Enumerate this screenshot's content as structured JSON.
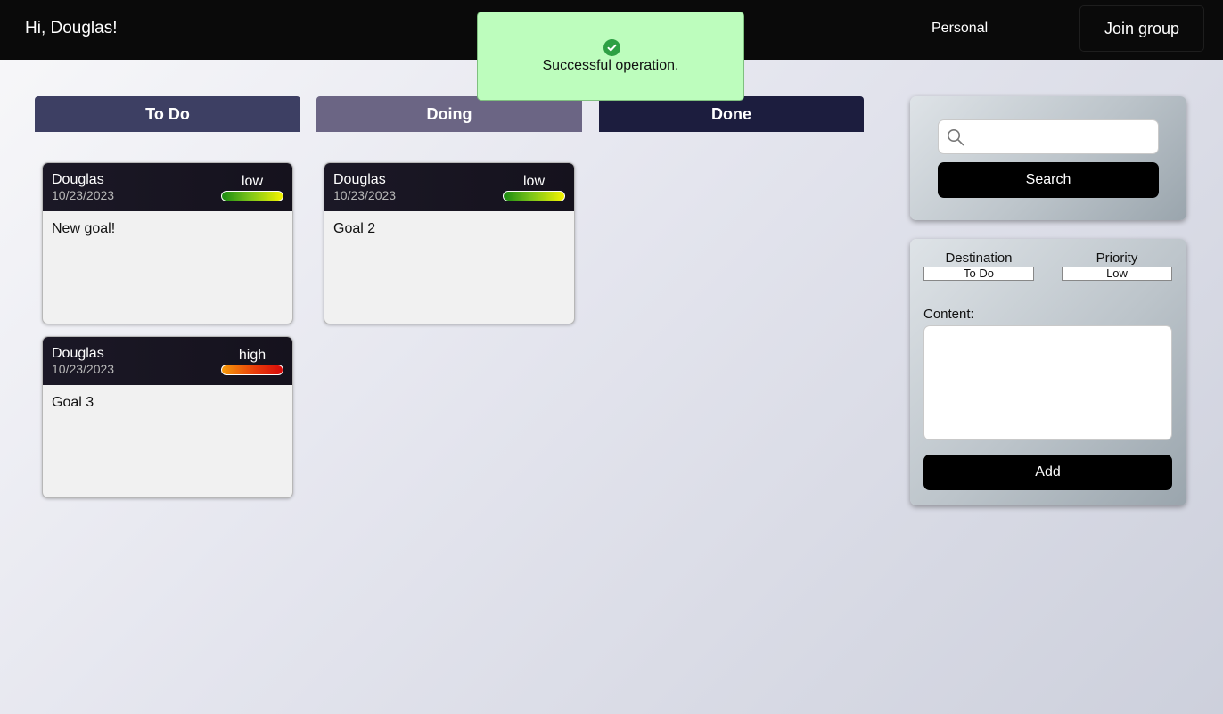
{
  "header": {
    "greeting": "Hi, Douglas!",
    "nav_personal": "Personal",
    "nav_join_group": "Join group"
  },
  "toast": {
    "icon": "check-circle-icon",
    "message": "Successful operation.",
    "color": "#bdfdbd"
  },
  "columns": [
    {
      "label": "To Do",
      "color": "#3d3f63"
    },
    {
      "label": "Doing",
      "color": "#6b6584"
    },
    {
      "label": "Done",
      "color": "#1c1d3e"
    }
  ],
  "cards": {
    "todo": [
      {
        "author": "Douglas",
        "date": "10/23/2023",
        "priority": "low",
        "content": "New goal!"
      },
      {
        "author": "Douglas",
        "date": "10/23/2023",
        "priority": "high",
        "content": "Goal 3"
      }
    ],
    "doing": [
      {
        "author": "Douglas",
        "date": "10/23/2023",
        "priority": "low",
        "content": "Goal 2"
      }
    ],
    "done": []
  },
  "search_panel": {
    "icon": "search-icon",
    "input_value": "",
    "search_label": "Search"
  },
  "add_panel": {
    "destination_label": "Destination",
    "destination_value": "To Do",
    "priority_label": "Priority",
    "priority_value": "Low",
    "content_label": "Content:",
    "content_value": "",
    "add_label": "Add"
  }
}
